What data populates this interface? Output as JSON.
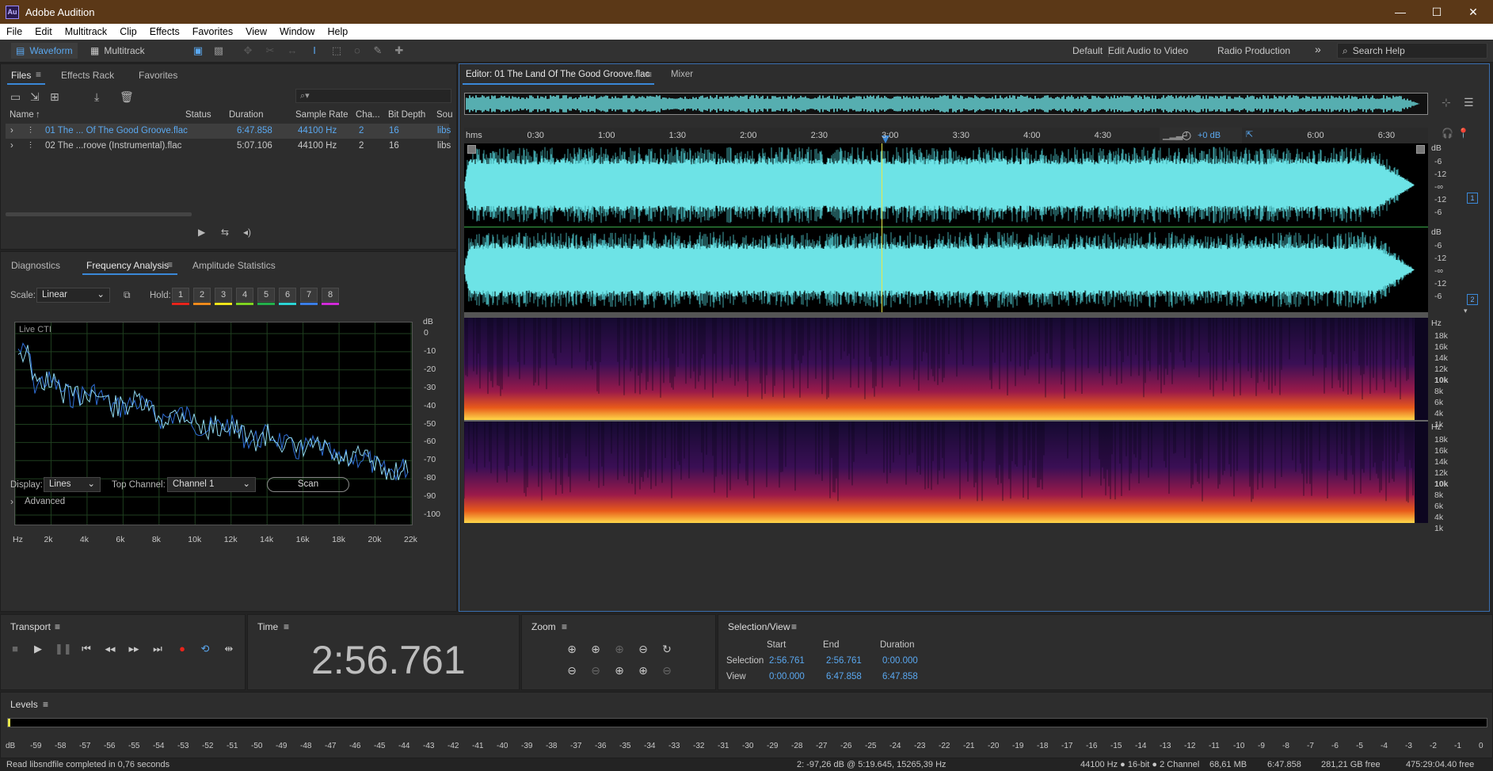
{
  "window": {
    "logo": "Au",
    "title": "Adobe Audition",
    "controls": [
      "—",
      "☐",
      "✕"
    ]
  },
  "menu": [
    "File",
    "Edit",
    "Multitrack",
    "Clip",
    "Effects",
    "Favorites",
    "View",
    "Window",
    "Help"
  ],
  "toolbar": {
    "waveform_label": "Waveform",
    "multitrack_label": "Multitrack",
    "workspaces": [
      "Default",
      "Edit Audio to Video",
      "Radio Production"
    ],
    "overflow": "»",
    "search_placeholder": "Search Help"
  },
  "files_panel": {
    "tabs": [
      "Files",
      "Effects Rack",
      "Favorites"
    ],
    "columns": [
      "Name",
      "Status",
      "Duration",
      "Sample Rate",
      "Cha...",
      "Bit Depth",
      "Sou"
    ],
    "rows": [
      {
        "name": "01 The ... Of The Good Groove.flac",
        "status": "",
        "duration": "6:47.858",
        "sample_rate": "44100 Hz",
        "channels": "2",
        "bit_depth": "16",
        "source": "libs",
        "selected": true
      },
      {
        "name": "02 The ...roove (Instrumental).flac",
        "status": "",
        "duration": "5:07.106",
        "sample_rate": "44100 Hz",
        "channels": "2",
        "bit_depth": "16",
        "source": "libs",
        "selected": false
      }
    ]
  },
  "analysis_panel": {
    "tabs": [
      "Diagnostics",
      "Frequency Analysis",
      "Amplitude Statistics"
    ],
    "scale_label": "Scale:",
    "scale_value": "Linear",
    "hold_label": "Hold:",
    "hold_buttons": [
      "1",
      "2",
      "3",
      "4",
      "5",
      "6",
      "7",
      "8"
    ],
    "hold_colors": [
      "#e8241b",
      "#f08a1c",
      "#f3e61a",
      "#7fd321",
      "#22b04a",
      "#2bd3d3",
      "#3a7ee8",
      "#d02ad8"
    ],
    "plot_label": "Live CTI",
    "db_unit": "dB",
    "db_ticks": [
      "0",
      "-10",
      "-20",
      "-30",
      "-40",
      "-50",
      "-60",
      "-70",
      "-80",
      "-90",
      "-100"
    ],
    "freq_ticks": [
      "Hz",
      "2k",
      "4k",
      "6k",
      "8k",
      "10k",
      "12k",
      "14k",
      "16k",
      "18k",
      "20k",
      "22k"
    ],
    "display_label": "Display:",
    "display_value": "Lines",
    "top_channel_label": "Top Channel:",
    "top_channel_value": "Channel 1",
    "scan_label": "Scan",
    "advanced_label": "Advanced"
  },
  "editor": {
    "tabs": [
      "Editor: 01 The Land Of The Good Groove.flac",
      "Mixer"
    ],
    "ruler_unit": "hms",
    "ruler_ticks": [
      "0:30",
      "1:00",
      "1:30",
      "2:00",
      "2:30",
      "3:00",
      "3:30",
      "4:00",
      "4:30",
      "6:00",
      "6:30"
    ],
    "volume_hud": "+0 dB",
    "db_unit": "dB",
    "channel_db_ticks": [
      "-6",
      "-12",
      "-∞",
      "-12",
      "-6"
    ],
    "channels": [
      "1",
      "2"
    ],
    "hz_unit": "Hz",
    "spectral_ticks": [
      "18k",
      "16k",
      "14k",
      "12k",
      "10k",
      "8k",
      "6k",
      "4k",
      "1k"
    ],
    "playhead_time_sec": 176.761,
    "duration_sec": 407.858
  },
  "transport": {
    "title": "Transport"
  },
  "time_panel": {
    "title": "Time",
    "value": "2:56.761"
  },
  "zoom_panel": {
    "title": "Zoom"
  },
  "selection_panel": {
    "title": "Selection/View",
    "headers": [
      "Start",
      "End",
      "Duration"
    ],
    "rows": [
      {
        "label": "Selection",
        "start": "2:56.761",
        "end": "2:56.761",
        "duration": "0:00.000"
      },
      {
        "label": "View",
        "start": "0:00.000",
        "end": "6:47.858",
        "duration": "6:47.858"
      }
    ]
  },
  "levels_panel": {
    "title": "Levels",
    "scale": [
      "dB",
      "-59",
      "-58",
      "-57",
      "-56",
      "-55",
      "-54",
      "-53",
      "-52",
      "-51",
      "-50",
      "-49",
      "-48",
      "-47",
      "-46",
      "-45",
      "-44",
      "-43",
      "-42",
      "-41",
      "-40",
      "-39",
      "-38",
      "-37",
      "-36",
      "-35",
      "-34",
      "-33",
      "-32",
      "-31",
      "-30",
      "-29",
      "-28",
      "-27",
      "-26",
      "-25",
      "-24",
      "-23",
      "-22",
      "-21",
      "-20",
      "-19",
      "-18",
      "-17",
      "-16",
      "-15",
      "-14",
      "-13",
      "-12",
      "-11",
      "-10",
      "-9",
      "-8",
      "-7",
      "-6",
      "-5",
      "-4",
      "-3",
      "-2",
      "-1",
      "0"
    ]
  },
  "status": {
    "message": "Read libsndfile completed in 0,76 seconds",
    "cursor": "2: -97,26 dB @ 5:19.645, 15265,39 Hz",
    "format": "44100 Hz ● 16-bit ● 2 Channel",
    "size": "68,61 MB",
    "duration": "6:47.858",
    "free_space": "281,21 GB free",
    "free_time": "475:29:04.40 free"
  },
  "colors": {
    "waveform": "#6de3e6",
    "accent": "#3a88d8",
    "playhead": "#e8e84a",
    "value_blue": "#5aa8f0",
    "titlebar": "#5b3817"
  }
}
